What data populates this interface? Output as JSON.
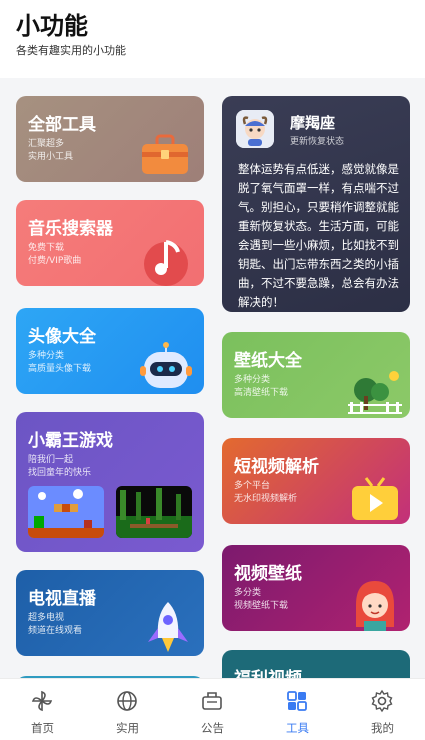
{
  "header": {
    "title": "小功能",
    "subtitle": "各类有趣实用的小功能"
  },
  "cards": {
    "all_tools": {
      "title": "全部工具",
      "line1": "汇聚超多",
      "line2": "实用小工具",
      "icon": "toolbox-icon"
    },
    "music": {
      "title": "音乐搜索器",
      "line1": "免费下载",
      "line2": "付费/VIP歌曲",
      "icon": "music-note-icon"
    },
    "avatar": {
      "title": "头像大全",
      "line1": "多种分类",
      "line2": "高质量头像下载",
      "icon": "robot-icon"
    },
    "game": {
      "title": "小霸王游戏",
      "line1": "陪我们一起",
      "line2": "找回童年的快乐"
    },
    "tv": {
      "title": "电视直播",
      "line1": "超多电视",
      "line2": "频道在线观看",
      "icon": "rocket-icon"
    },
    "astro": {
      "name": "摩羯座",
      "sub": "更新恢复状态",
      "text": "整体运势有点低迷，感觉就像是脱了氧气面罩一样，有点喘不过气。别担心，只要稍作调整就能重新恢复状态。生活方面，可能会遇到一些小麻烦，比如找不到钥匙、出门忘带东西之类的小插曲，不过不要急躁，总会有办法解决的！"
    },
    "wallpaper": {
      "title": "壁纸大全",
      "line1": "多种分类",
      "line2": "高清壁纸下载",
      "icon": "garden-icon"
    },
    "video_parse": {
      "title": "短视频解析",
      "line1": "多个平台",
      "line2": "无水印视频解析",
      "icon": "play-tv-icon"
    },
    "video_wall": {
      "title": "视频壁纸",
      "line1": "多分类",
      "line2": "视频壁纸下载",
      "icon": "girl-avatar-icon"
    },
    "welfare": {
      "title": "福利视频"
    }
  },
  "tabs": [
    {
      "label": "首页",
      "icon": "pinwheel-icon",
      "active": false
    },
    {
      "label": "实用",
      "icon": "globe-icon",
      "active": false
    },
    {
      "label": "公告",
      "icon": "megaphone-icon",
      "active": false
    },
    {
      "label": "工具",
      "icon": "grid-tools-icon",
      "active": true
    },
    {
      "label": "我的",
      "icon": "gear-icon",
      "active": false
    }
  ],
  "colors": {
    "accent": "#3a7bf2"
  }
}
